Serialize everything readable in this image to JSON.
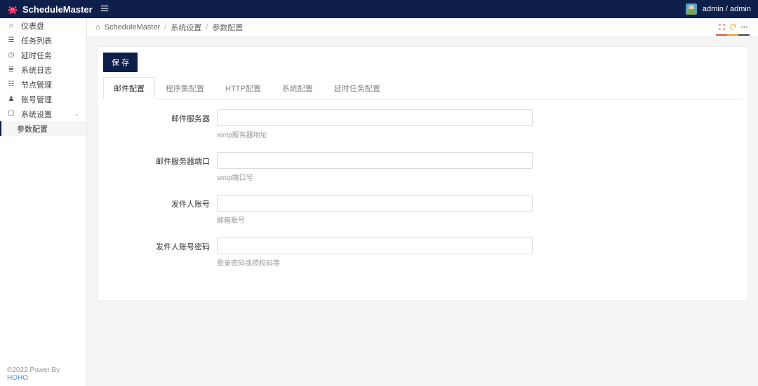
{
  "brand": {
    "name": "ScheduleMaster"
  },
  "user": {
    "display": "admin / admin"
  },
  "sidebar": {
    "items": [
      {
        "icon": "home",
        "label": "仪表盘"
      },
      {
        "icon": "list",
        "label": "任务列表"
      },
      {
        "icon": "clock",
        "label": "延时任务"
      },
      {
        "icon": "log",
        "label": "系统日志"
      },
      {
        "icon": "nodes",
        "label": "节点管理"
      },
      {
        "icon": "user",
        "label": "账号管理"
      },
      {
        "icon": "cog",
        "label": "系统设置"
      }
    ],
    "sub": {
      "label": "参数配置"
    }
  },
  "breadcrumb": {
    "root": "ScheduleMaster",
    "level1": "系统设置",
    "level2": "参数配置"
  },
  "toolbar": {
    "save_label": "保 存"
  },
  "config_tabs": [
    {
      "label": "邮件配置",
      "active": true
    },
    {
      "label": "程序集配置"
    },
    {
      "label": "HTTP配置"
    },
    {
      "label": "系统配置"
    },
    {
      "label": "延时任务配置"
    }
  ],
  "form": {
    "smtp_server": {
      "label": "邮件服务器",
      "value": "",
      "help": "smtp服务器地址"
    },
    "smtp_port": {
      "label": "邮件服务器端口",
      "value": "",
      "help": "smtp端口号"
    },
    "sender_account": {
      "label": "发件人账号",
      "value": "",
      "help": "邮箱账号"
    },
    "sender_password": {
      "label": "发件人账号密码",
      "value": "",
      "help": "登录密码或授权码等"
    }
  },
  "footer": {
    "prefix": "©2022 Power By ",
    "link": "HOHO"
  }
}
